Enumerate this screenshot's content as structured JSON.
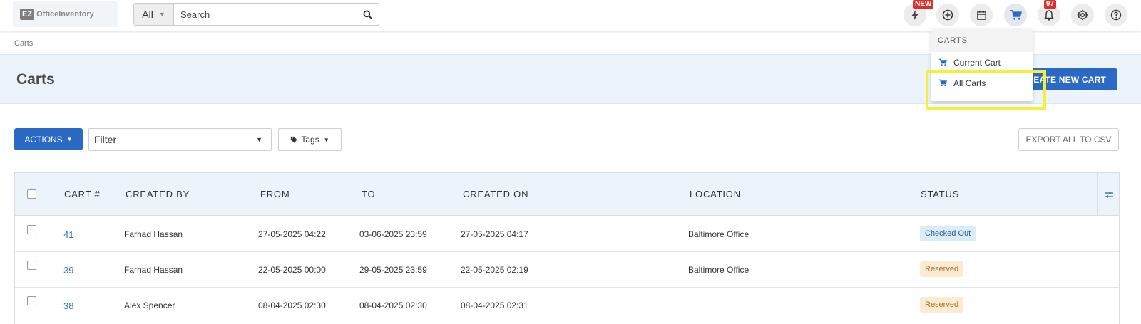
{
  "app": {
    "logo_mark": "EZ",
    "logo_name": "OfficeInventory"
  },
  "search": {
    "scope": "All",
    "placeholder": "Search"
  },
  "topbar": {
    "new_badge": "NEW",
    "notification_count": "97"
  },
  "breadcrumb": "Carts",
  "page": {
    "title": "Carts",
    "create_button": "CREATE NEW CART"
  },
  "dropdown": {
    "heading": "CARTS",
    "items": [
      {
        "label": "Current Cart"
      },
      {
        "label": "All Carts"
      }
    ]
  },
  "toolbar": {
    "actions_label": "ACTIONS",
    "filter_value": "Filter",
    "tags_label": "Tags",
    "export_label": "EXPORT ALL TO CSV"
  },
  "table": {
    "columns": [
      "CART #",
      "CREATED BY",
      "FROM",
      "TO",
      "CREATED ON",
      "LOCATION",
      "STATUS"
    ],
    "rows": [
      {
        "cart": "41",
        "created_by": "Farhad Hassan",
        "from": "27-05-2025 04:22",
        "to": "03-06-2025 23:59",
        "created_on": "27-05-2025 04:17",
        "location": "Baltimore Office",
        "status": "Checked Out"
      },
      {
        "cart": "39",
        "created_by": "Farhad Hassan",
        "from": "22-05-2025 00:00",
        "to": "29-05-2025 23:59",
        "created_on": "22-05-2025 02:19",
        "location": "Baltimore Office",
        "status": "Reserved"
      },
      {
        "cart": "38",
        "created_by": "Alex Spencer",
        "from": "08-04-2025 02:30",
        "to": "08-04-2025 02:30",
        "created_on": "08-04-2025 02:31",
        "location": "",
        "status": "Reserved"
      }
    ]
  },
  "colors": {
    "primary": "#2a6ac5",
    "header_band": "#ecf3fb",
    "highlight": "#f5ef3a",
    "badge": "#d9302f"
  }
}
